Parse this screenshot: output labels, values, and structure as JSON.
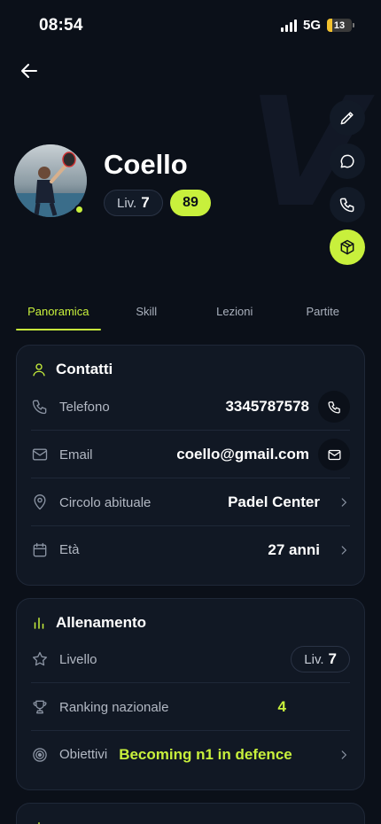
{
  "status": {
    "time": "08:54",
    "network": "5G",
    "battery": "13"
  },
  "profile": {
    "name": "Coello",
    "level_prefix": "Liv.",
    "level": "7",
    "score": "89"
  },
  "tabs": [
    {
      "label": "Panoramica",
      "active": true
    },
    {
      "label": "Skill"
    },
    {
      "label": "Lezioni"
    },
    {
      "label": "Partite"
    }
  ],
  "contacts": {
    "title": "Contatti",
    "phone_label": "Telefono",
    "phone_value": "3345787578",
    "email_label": "Email",
    "email_value": "coello@gmail.com",
    "club_label": "Circolo abituale",
    "club_value": "Padel Center",
    "age_label": "Età",
    "age_value": "27 anni"
  },
  "training": {
    "title": "Allenamento",
    "level_label": "Livello",
    "level_prefix": "Liv.",
    "level_value": "7",
    "ranking_label": "Ranking nazionale",
    "ranking_value": "4",
    "goals_label": "Obiettivi",
    "goals_value": "Becoming n1 in defence"
  },
  "colors": {
    "accent": "#c8f03c",
    "background": "#0b1019",
    "card": "#111824"
  }
}
